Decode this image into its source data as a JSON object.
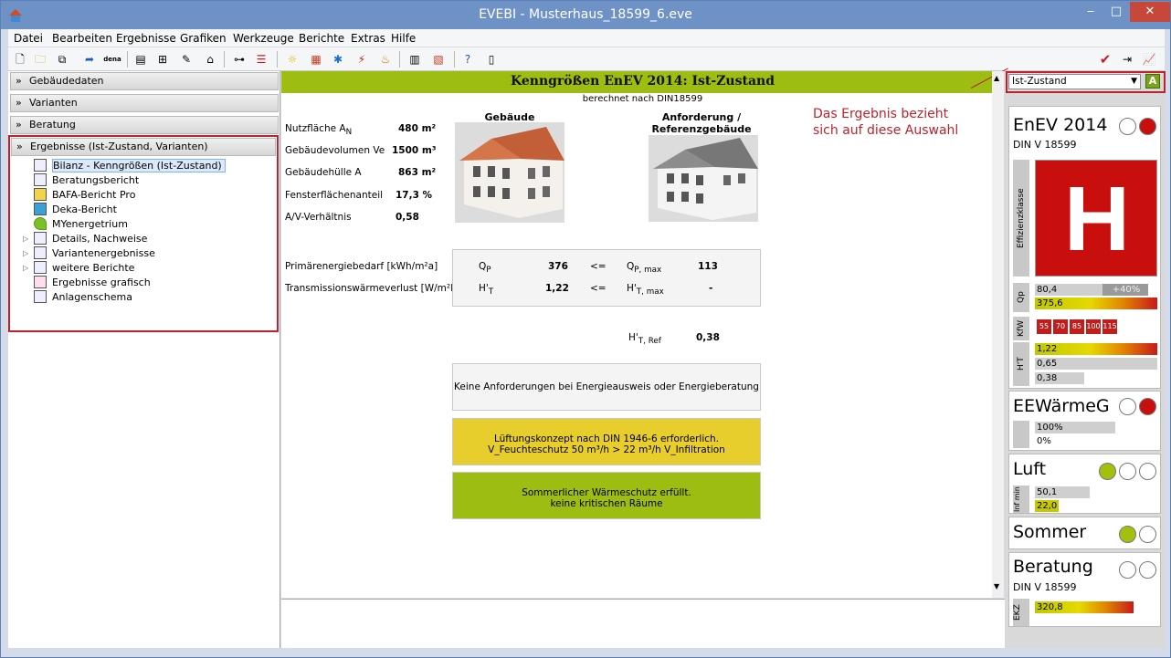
{
  "window": {
    "title": "EVEBI - Musterhaus_18599_6.eve",
    "min": "‒",
    "max": "□",
    "close": "✕"
  },
  "menu": [
    "Datei",
    "Bearbeiten",
    "Ergebnisse",
    "Grafiken",
    "Werkzeuge",
    "Berichte",
    "Extras",
    "Hilfe"
  ],
  "toolbar": {
    "dena": "dena"
  },
  "left": {
    "sections": [
      "Gebäudedaten",
      "Varianten",
      "Beratung",
      "Ergebnisse (Ist-Zustand, Varianten)"
    ],
    "tree": [
      "Bilanz - Kenngrößen (Ist-Zustand)",
      "Beratungsbericht",
      "BAFA-Bericht Pro",
      "Deka-Bericht",
      "MYenergetrium",
      "Details, Nachweise",
      "Variantenergebnisse",
      "weitere Berichte",
      "Ergebnisse grafisch",
      "Anlagenschema"
    ]
  },
  "center": {
    "title": "Kenngrößen EnEV 2014: Ist-Zustand",
    "subtitle": "berechnet nach DIN18599",
    "nutz_label": "Nutzfläche A",
    "nutz_sub": "N",
    "nutz_val": "480 m²",
    "vol_label": "Gebäudevolumen Ve",
    "vol_val": "1500 m³",
    "huelle_label": "Gebäudehülle A",
    "huelle_val": "863 m²",
    "fenster_label": "Fensterflächenanteil",
    "fenster_val": "17,3 %",
    "av_label": "A/V-Verhältnis",
    "av_val": "0,58",
    "gebaeude": "Gebäude",
    "anforderung": "Anforderung / Referenzgebäude",
    "pe_label": "Primärenergiebedarf [kWh/m²a]",
    "tw_label": "Transmissionswärmeverlust [W/m²K]",
    "qp": "Q",
    "qp_sub": "P",
    "qp_val": "376",
    "le": "<=",
    "qpmax": "Q",
    "qpmax_sub": "P, max",
    "qpmax_val": "113",
    "ht": "H'",
    "ht_sub": "T",
    "ht_val": "1,22",
    "le2": "<=",
    "htmax": "H'",
    "htmax_sub": "T, max",
    "htmax_val": "-",
    "htref": "H'",
    "htref_sub": "T, Ref",
    "htref_val": "0,38",
    "box1": "Keine Anforderungen bei Energieausweis oder Energieberatung",
    "box2a": "Lüftungskonzept nach DIN 1946-6 erforderlich.",
    "box2b": "V_Feuchteschutz  50 m³/h >  22 m³/h V_Infiltration",
    "box3a": "Sommerlicher Wärmeschutz erfüllt.",
    "box3b": "keine kritischen Räume"
  },
  "annotation": {
    "line1": "Das Ergebnis bezieht",
    "line2": "sich auf diese Auswahl"
  },
  "right": {
    "dropdown": "Ist-Zustand",
    "a_btn": "A",
    "enev_title": "EnEV 2014",
    "enev_sub": "DIN V 18599",
    "effklasse": "Effizienzklasse",
    "letter": "H",
    "qp_lab": "Qp",
    "qp_bar1": "80,4",
    "qp_bar1_extra": "+40%",
    "qp_bar2": "375,6",
    "kw_lab": "KfW",
    "kw": [
      "55",
      "70",
      "85",
      "100",
      "115"
    ],
    "ht_lab": "H'T",
    "ht1": "1,22",
    "ht2": "0,65",
    "ht3": "0,38",
    "ee_title": "EEWärmeG",
    "ee1": "100%",
    "ee2": "0%",
    "luft_title": "Luft",
    "luft_lab": "Inf min",
    "luft1": "50,1",
    "luft2": "22,0",
    "sommer_title": "Sommer",
    "ber_title": "Beratung",
    "ber_sub": "DIN V 18599",
    "ekz_lab": "EKZ",
    "ekz_val": "320,8"
  },
  "colors": {
    "accent": "#9ebd12",
    "red": "#c90e0e",
    "annot": "#c0202a"
  }
}
